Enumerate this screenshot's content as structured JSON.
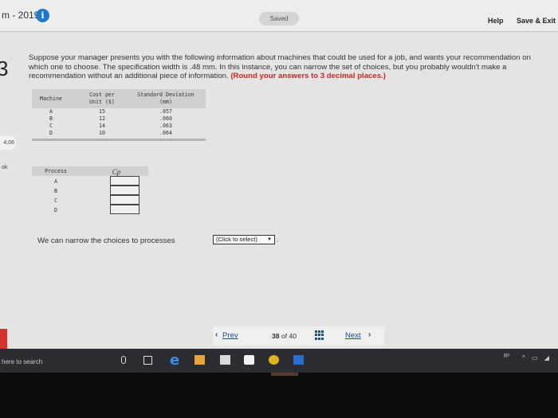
{
  "header": {
    "course_title": "m - 2019",
    "info_icon": "info-icon",
    "saved_label": "Saved",
    "help_label": "Help",
    "save_exit_label": "Save & Exit"
  },
  "sidebar": {
    "question_number": "3",
    "badge_text": "4:06",
    "ok_text": "ok"
  },
  "question": {
    "prompt": "Suppose your manager presents you with the following information about machines that could be used for a job, and wants your recommendation on which one to choose. The specification width is .48 mm. In this instance, you can narrow the set of choices, but you probably wouldn't make a recommendation without an additional piece of information.",
    "instruction": "(Round your answers to 3 decimal places.)"
  },
  "machine_table": {
    "headers": {
      "machine": "Machine",
      "cost_line1": "Cost per",
      "cost_line2": "Unit ($)",
      "sd_line1": "Standard Deviation",
      "sd_line2": "(mm)"
    },
    "rows": [
      {
        "machine": "A",
        "cost": "15",
        "sd": ".057"
      },
      {
        "machine": "B",
        "cost": "12",
        "sd": ".060"
      },
      {
        "machine": "C",
        "cost": "14",
        "sd": ".063"
      },
      {
        "machine": "D",
        "cost": "10",
        "sd": ".064"
      }
    ]
  },
  "process_table": {
    "headers": {
      "process": "Process",
      "cp": "Cp"
    },
    "rows": [
      {
        "process": "A",
        "cp": ""
      },
      {
        "process": "B",
        "cp": ""
      },
      {
        "process": "C",
        "cp": ""
      },
      {
        "process": "D",
        "cp": ""
      }
    ]
  },
  "narrow": {
    "text": "We can narrow the choices to processes",
    "select_value": "(Click to select)",
    "period": "."
  },
  "pager": {
    "prev_label": "Prev",
    "current": "38",
    "of_label": "of",
    "total": "40",
    "next_label": "Next",
    "grid_icon": "grid-icon"
  },
  "taskbar": {
    "search_text": "here to search",
    "tray_text": "R²"
  },
  "colors": {
    "accent_blue": "#1f78c8",
    "link_blue": "#1f4c8a",
    "warning_red": "#c5282a"
  }
}
